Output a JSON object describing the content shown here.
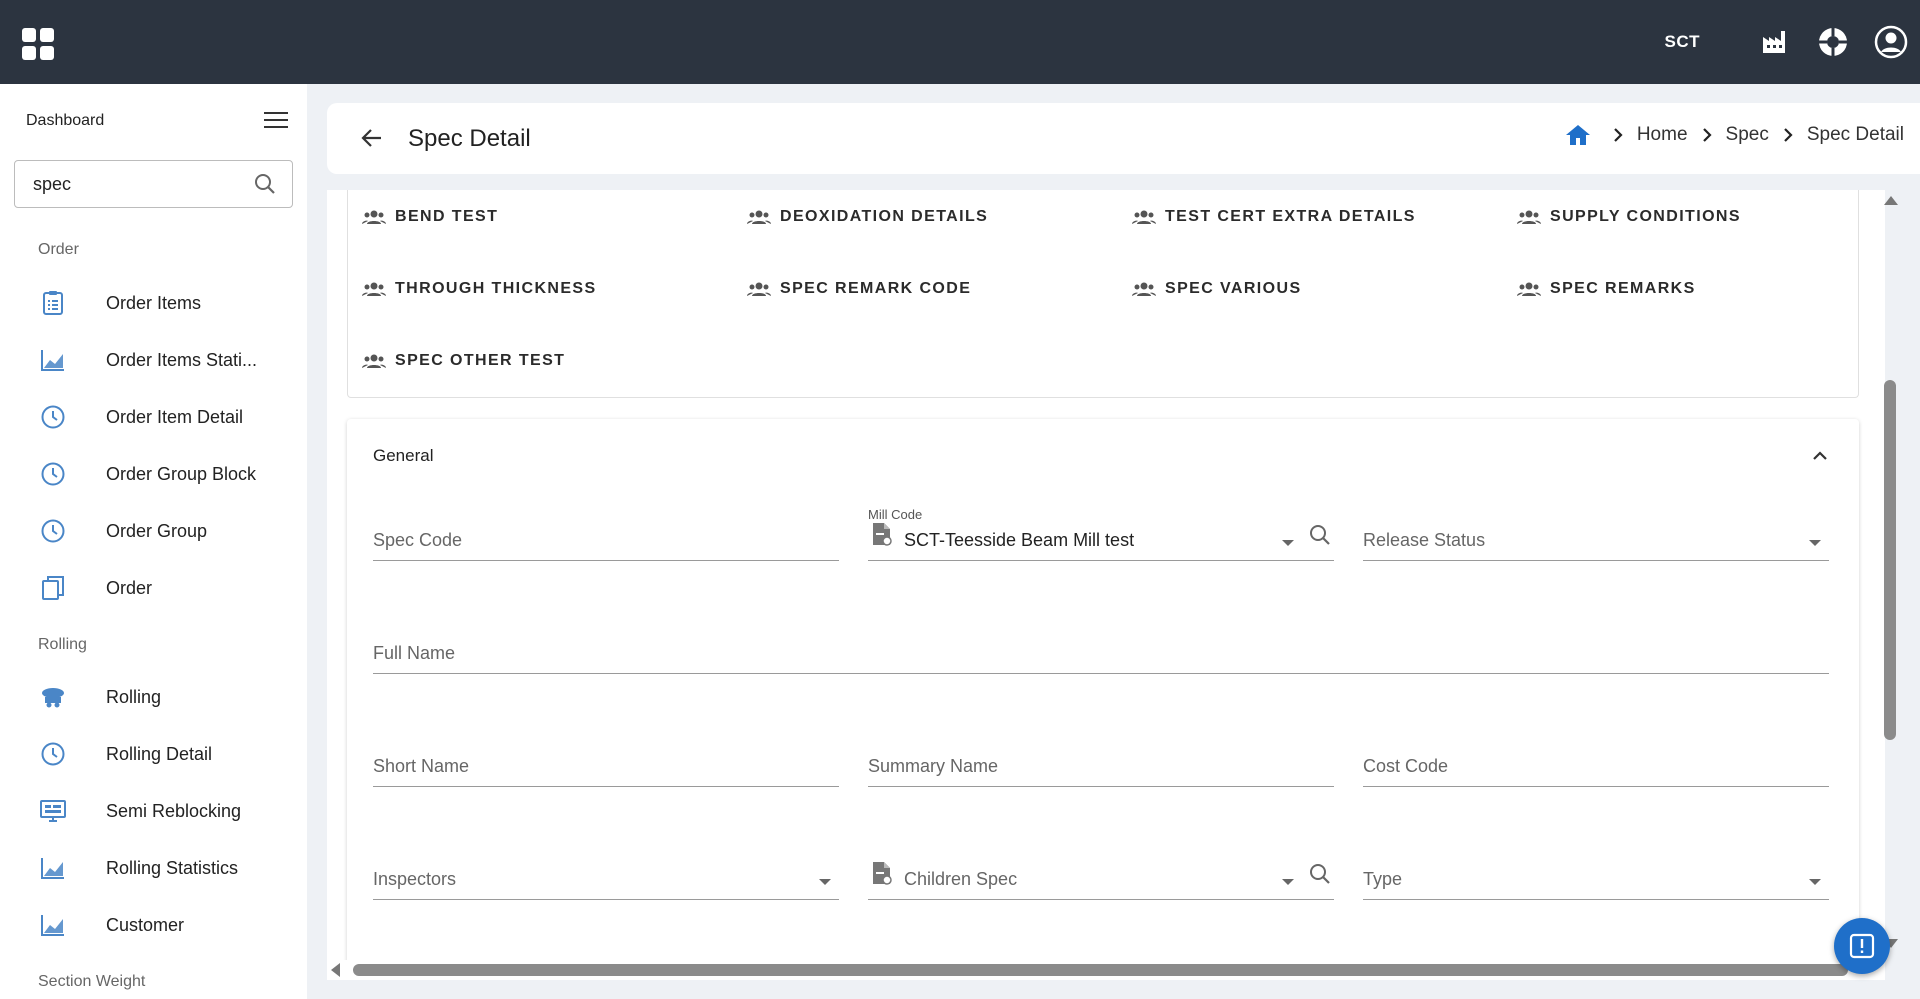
{
  "topbar": {
    "org_label": "SCT",
    "icons": [
      "apps-icon",
      "factory-icon",
      "support-icon",
      "account-icon"
    ]
  },
  "sidebar": {
    "header": "Dashboard",
    "search": {
      "value": "spec",
      "placeholder": ""
    },
    "sections": [
      {
        "label": "Order"
      },
      {
        "label": "Rolling"
      },
      {
        "label": "Section Weight"
      }
    ],
    "items": [
      {
        "label": "Order Items",
        "icon": "clipboard-list-icon"
      },
      {
        "label": "Order Items Stati...",
        "icon": "chart-line-icon"
      },
      {
        "label": "Order Item Detail",
        "icon": "clock-icon"
      },
      {
        "label": "Order Group Block",
        "icon": "clock-icon"
      },
      {
        "label": "Order Group",
        "icon": "clock-icon"
      },
      {
        "label": "Order",
        "icon": "clipboard-copy-icon"
      },
      {
        "label": "Rolling",
        "icon": "rolling-icon"
      },
      {
        "label": "Rolling Detail",
        "icon": "clock-icon"
      },
      {
        "label": "Semi Reblocking",
        "icon": "monitor-icon"
      },
      {
        "label": "Rolling Statistics",
        "icon": "chart-line-icon"
      },
      {
        "label": "Customer",
        "icon": "chart-line-icon"
      }
    ]
  },
  "header": {
    "title": "Spec Detail",
    "breadcrumb": [
      "Home",
      "Spec",
      "Spec Detail"
    ]
  },
  "links": [
    "BEND TEST",
    "DEOXIDATION DETAILS",
    "TEST CERT EXTRA DETAILS",
    "SUPPLY CONDITIONS",
    "THROUGH THICKNESS",
    "SPEC REMARK CODE",
    "SPEC VARIOUS",
    "SPEC REMARKS",
    "SPEC OTHER TEST"
  ],
  "general": {
    "title": "General",
    "fields": {
      "spec_code": {
        "label": "Spec Code"
      },
      "mill_code": {
        "label": "Mill Code",
        "value": "SCT-Teesside Beam Mill test"
      },
      "release_status": {
        "label": "Release Status"
      },
      "full_name": {
        "label": "Full Name"
      },
      "short_name": {
        "label": "Short Name"
      },
      "summary_name": {
        "label": "Summary Name"
      },
      "cost_code": {
        "label": "Cost Code"
      },
      "inspectors": {
        "label": "Inspectors"
      },
      "children_spec": {
        "label": "Children Spec"
      },
      "type": {
        "label": "Type"
      }
    }
  },
  "colors": {
    "topbar": "#2c3440",
    "accent": "#1f6fc9",
    "icon_blue": "#4a86c7"
  }
}
